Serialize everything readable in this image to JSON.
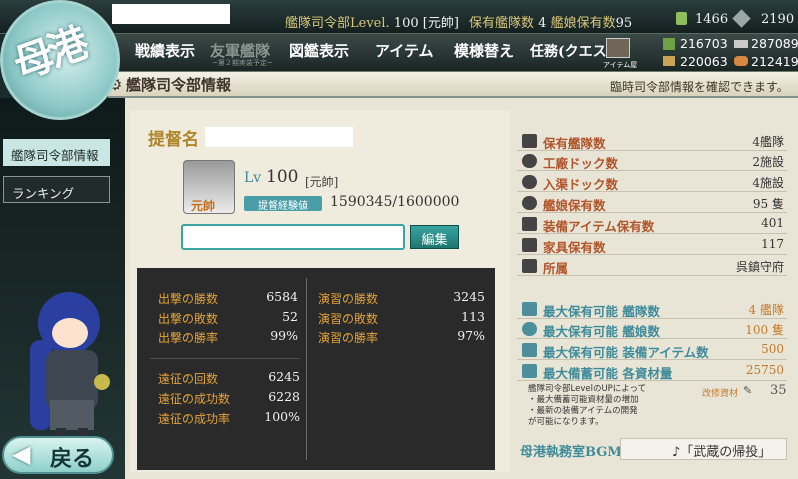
{
  "header": {
    "hq_level_label": "艦隊司令部Level.",
    "hq_level": "100",
    "rank_short": "[元帥]",
    "ships_owned_label": "保有艦隊数",
    "ships_owned": "4",
    "girls_owned_label": "艦娘保有数",
    "girls_owned": "95",
    "bucket": "1466",
    "devmat": "2190"
  },
  "menu": {
    "items": [
      "戦績表示",
      "友軍艦隊",
      "図鑑表示",
      "アイテム",
      "模様替え",
      "任務(クエスト)"
    ],
    "friend_sub": "~第２期実装予定~",
    "item_shop": "アイテム屋"
  },
  "resources": {
    "fuel": "216703",
    "steel": "287089",
    "ammo": "220063",
    "bauxite": "212419"
  },
  "title": {
    "text": "艦隊司令部情報",
    "subtitle": "臨時司令部情報を確認できます。"
  },
  "emblem": "母港",
  "sidebar": {
    "items": [
      "艦隊司令部情報",
      "ランキング"
    ]
  },
  "back_label": "戻る",
  "profile": {
    "admiral_label": "提督名",
    "badge": "元帥",
    "lv_label": "Lv",
    "lv": "100",
    "rank": "[元帥]",
    "exp_label": "提督経験値",
    "exp": "1590345/1600000",
    "edit_label": "編集"
  },
  "battle": [
    {
      "label": "出撃の勝数",
      "value": "6584"
    },
    {
      "label": "出撃の敗数",
      "value": "52"
    },
    {
      "label": "出撃の勝率",
      "value": "99%"
    }
  ],
  "exercise": [
    {
      "label": "演習の勝数",
      "value": "3245"
    },
    {
      "label": "演習の敗数",
      "value": "113"
    },
    {
      "label": "演習の勝率",
      "value": "97%"
    }
  ],
  "expedition": [
    {
      "label": "遠征の回数",
      "value": "6245"
    },
    {
      "label": "遠征の成功数",
      "value": "6228"
    },
    {
      "label": "遠征の成功率",
      "value": "100%"
    }
  ],
  "info": [
    {
      "label": "保有艦隊数",
      "value": "4艦隊"
    },
    {
      "label": "工廠ドック数",
      "value": "2施設"
    },
    {
      "label": "入渠ドック数",
      "value": "4施設"
    },
    {
      "label": "艦娘保有数",
      "value": "95 隻"
    },
    {
      "label": "装備アイテム保有数",
      "value": "401"
    },
    {
      "label": "家具保有数",
      "value": "117"
    },
    {
      "label": "所属",
      "value": "呉鎮守府"
    }
  ],
  "limits": [
    {
      "label": "最大保有可能 艦隊数",
      "value": "4 艦隊"
    },
    {
      "label": "最大保有可能 艦娘数",
      "value": "100 隻"
    },
    {
      "label": "最大保有可能 装備アイテム数",
      "value": "500"
    },
    {
      "label": "最大備蓄可能 各資材量",
      "value": "25750"
    }
  ],
  "note": {
    "line1": "艦隊司令部LevelのUPによって",
    "line2": "・最大備蓄可能資材量の増加",
    "line3": "・最新の装備アイテムの開発",
    "line4": "が可能になります。"
  },
  "remodel": {
    "label": "改修資材",
    "value": "35"
  },
  "bgm": {
    "label": "母港執務室BGM",
    "value": "♪「武蔵の帰投」"
  }
}
